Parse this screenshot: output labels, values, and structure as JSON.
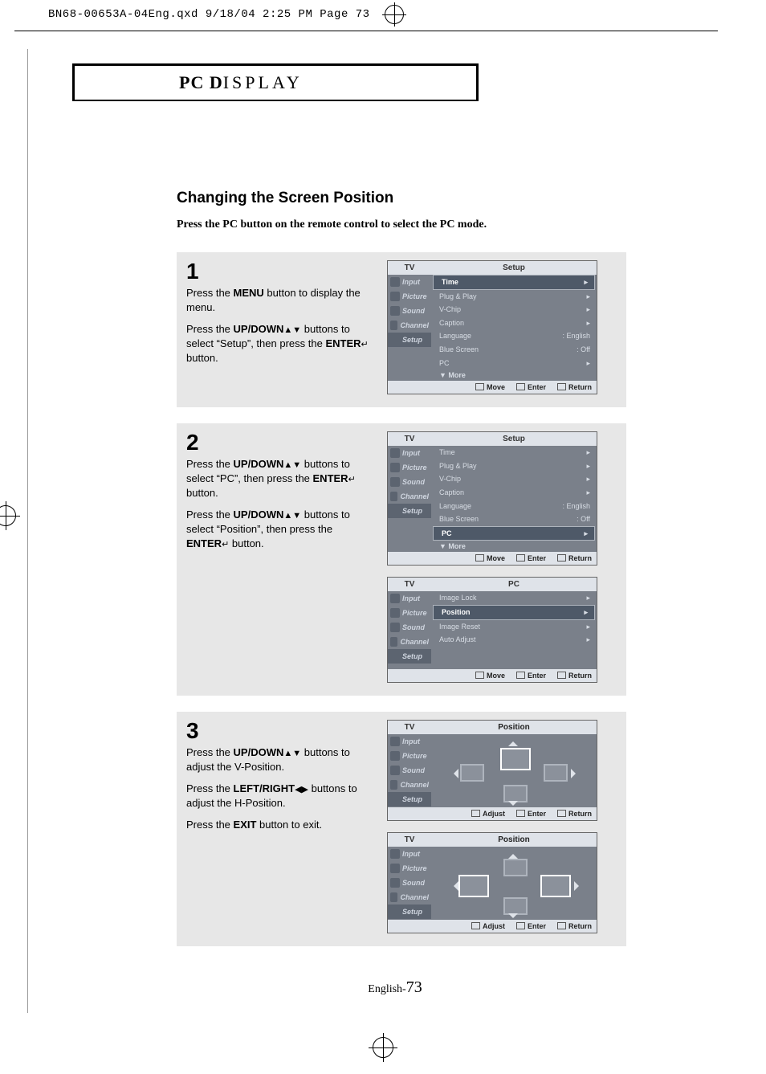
{
  "print_header": "BN68-00653A-04Eng.qxd  9/18/04 2:25 PM  Page 73",
  "section_title": {
    "bold1": "PC D",
    "rest": "ISPLAY"
  },
  "heading": "Changing the Screen Position",
  "lede": "Press the PC button on the remote control to select the PC mode.",
  "steps": {
    "s1": {
      "num": "1",
      "p1a": "Press the ",
      "p1b": "MENU",
      "p1c": " button to display the menu.",
      "p2a": "Press the ",
      "p2b": "UP/DOWN",
      "p2c": "▲▼",
      "p2d": " buttons to select “Setup”, then press the ",
      "p2e": "ENTER",
      "p2f": "↵",
      "p2g": " button."
    },
    "s2": {
      "num": "2",
      "p1a": "Press the ",
      "p1b": "UP/DOWN",
      "p1c": "▲▼",
      "p1d": " buttons to select “PC”, then press the ",
      "p1e": "ENTER",
      "p1f": "↵",
      "p1g": " button.",
      "p2a": "Press the ",
      "p2b": "UP/DOWN",
      "p2c": "▲▼",
      "p2d": " buttons to select “Position”, then press the ",
      "p2e": "ENTER",
      "p2f": "↵",
      "p2g": " button."
    },
    "s3": {
      "num": "3",
      "p1a": "Press the ",
      "p1b": "UP/DOWN",
      "p1c": "▲▼",
      "p1d": " buttons to adjust the V-Position.",
      "p2a": "Press the ",
      "p2b": "LEFT/RIGHT",
      "p2c": "◀▶",
      "p2d": " buttons to adjust the H-Position.",
      "p3a": "Press the ",
      "p3b": "EXIT",
      "p3c": " button to exit."
    }
  },
  "osd": {
    "tv": "TV",
    "side": [
      "Input",
      "Picture",
      "Sound",
      "Channel",
      "Setup"
    ],
    "setup_title": "Setup",
    "setup_items": [
      {
        "label": "Time",
        "value": "",
        "hi": true
      },
      {
        "label": "Plug & Play",
        "value": ""
      },
      {
        "label": "V-Chip",
        "value": ""
      },
      {
        "label": "Caption",
        "value": ""
      },
      {
        "label": "Language",
        "value": ":   English"
      },
      {
        "label": "Blue Screen",
        "value": ":   Off"
      },
      {
        "label": "PC",
        "value": ""
      }
    ],
    "more": "▼ More",
    "setup_items_pc_hi": [
      {
        "label": "Time",
        "value": ""
      },
      {
        "label": "Plug & Play",
        "value": ""
      },
      {
        "label": "V-Chip",
        "value": ""
      },
      {
        "label": "Caption",
        "value": ""
      },
      {
        "label": "Language",
        "value": ":   English"
      },
      {
        "label": "Blue Screen",
        "value": ":   Off"
      },
      {
        "label": "PC",
        "value": "",
        "hi": true
      }
    ],
    "pc_title": "PC",
    "pc_items": [
      {
        "label": "Image Lock",
        "value": ""
      },
      {
        "label": "Position",
        "value": "",
        "hi": true
      },
      {
        "label": "Image Reset",
        "value": ""
      },
      {
        "label": "Auto Adjust",
        "value": ""
      }
    ],
    "footer_move": "Move",
    "footer_enter": "Enter",
    "footer_return": "Return",
    "footer_adjust": "Adjust",
    "position_title": "Position"
  },
  "page_number_prefix": "English-",
  "page_number": "73"
}
